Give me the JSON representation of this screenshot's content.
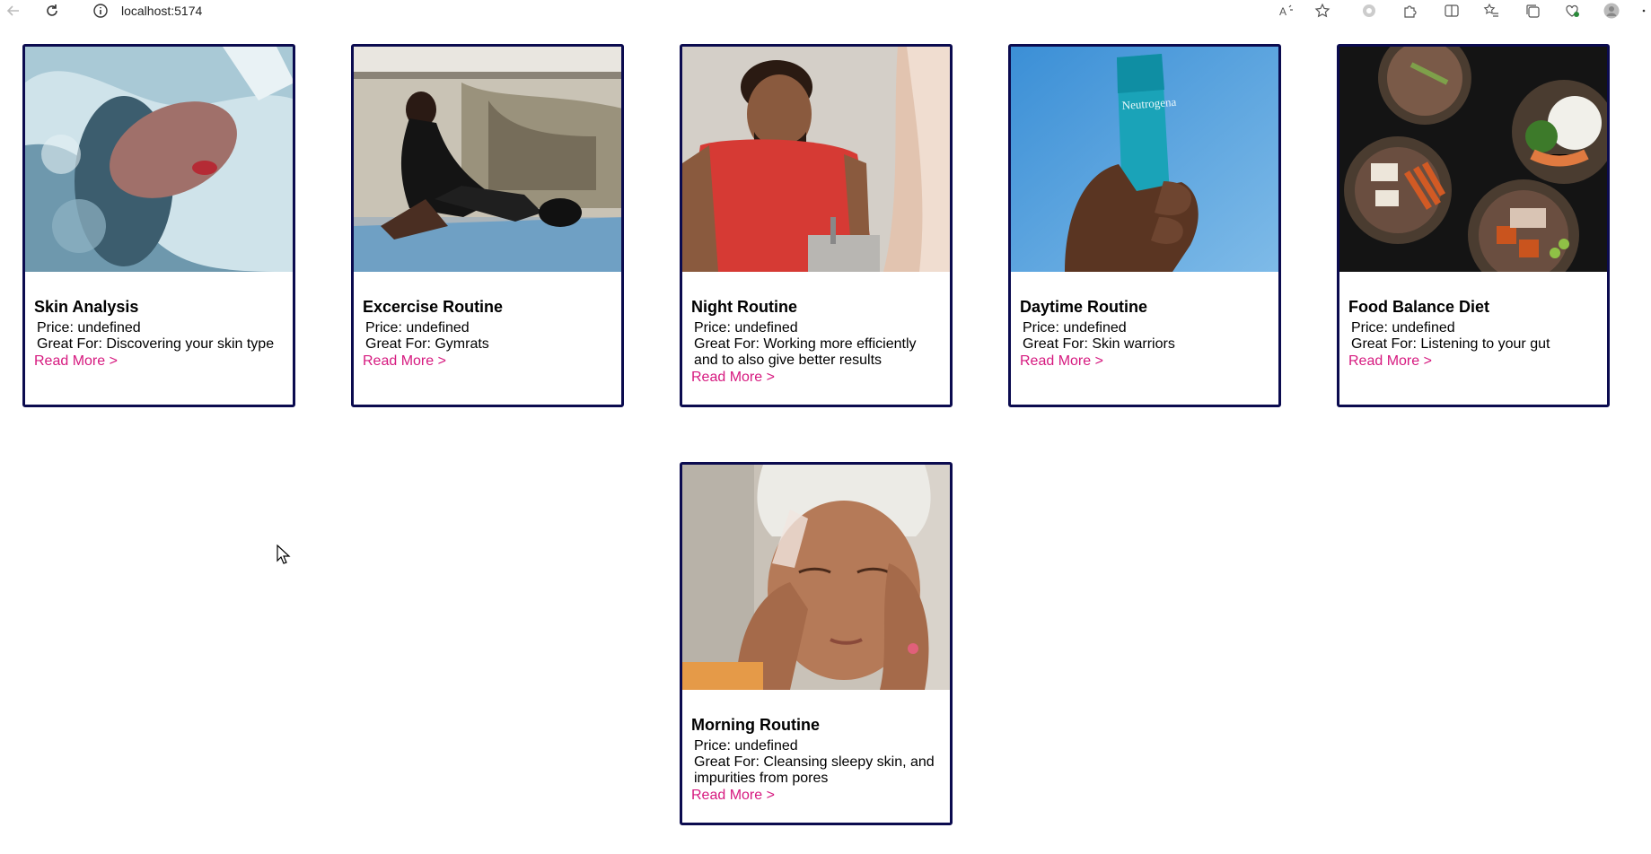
{
  "browser": {
    "url": "localhost:5174"
  },
  "cards": [
    {
      "title": "Skin Analysis",
      "price": "Price: undefined",
      "great_for": "Great For: Discovering your skin type",
      "link": "Read More >",
      "image": "woman-face-in-water"
    },
    {
      "title": "Excercise Routine",
      "price": "Price: undefined",
      "great_for": "Great For: Gymrats",
      "link": "Read More >",
      "image": "woman-stretching-on-mat"
    },
    {
      "title": "Night Routine",
      "price": "Price: undefined",
      "great_for": "Great For: Working more efficiently and to also give better results",
      "link": "Read More >",
      "image": "man-at-sink-mirror"
    },
    {
      "title": "Daytime Routine",
      "price": "Price: undefined",
      "great_for": "Great For: Skin warriors",
      "link": "Read More >",
      "image": "hand-holding-skincare-tube",
      "image_text": "Neutrogena"
    },
    {
      "title": "Food Balance Diet",
      "price": "Price: undefined",
      "great_for": "Great For: Listening to your gut",
      "link": "Read More >",
      "image": "food-bowls"
    },
    {
      "title": "Morning Routine",
      "price": "Price: undefined",
      "great_for": "Great For: Cleansing sleepy skin, and impurities from pores",
      "link": "Read More >",
      "image": "woman-using-face-roller"
    }
  ],
  "colors": {
    "card_border": "#0b0b4f",
    "link": "#d6197f"
  }
}
